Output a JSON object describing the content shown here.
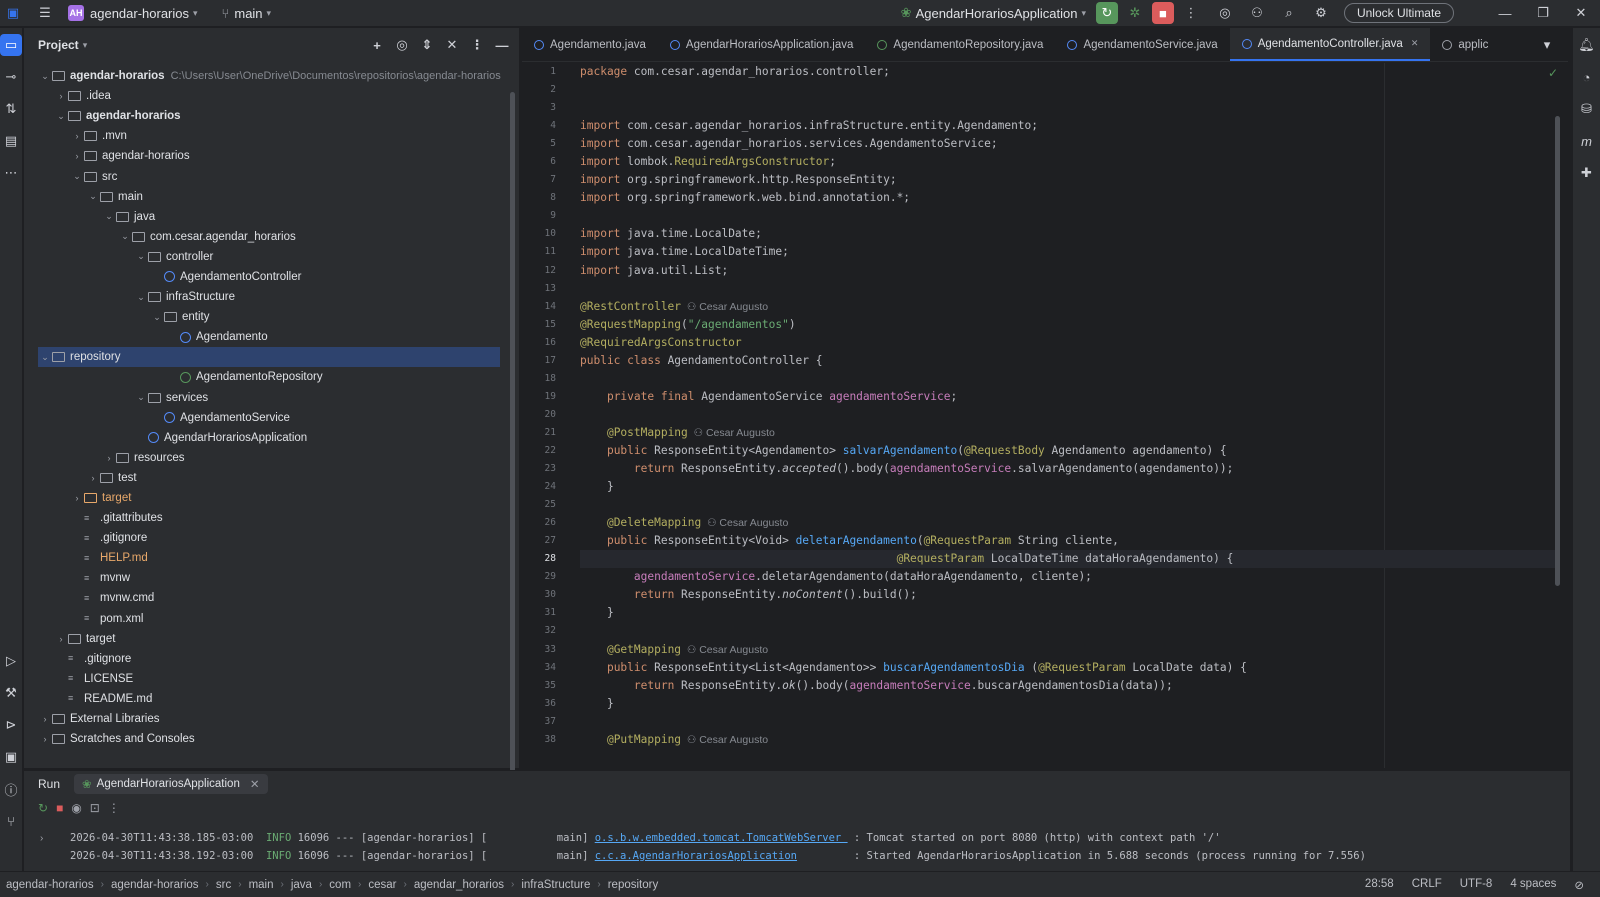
{
  "titlebar": {
    "project": "agendar-horarios",
    "branch": "main",
    "run_config": "AgendarHorariosApplication",
    "unlock": "Unlock Ultimate",
    "badge": "AH"
  },
  "project_panel": {
    "title": "Project"
  },
  "tree": [
    {
      "d": 0,
      "t": "v",
      "k": "m",
      "label": "agendar-horarios",
      "path": "C:\\Users\\User\\OneDrive\\Documentos\\repositorios\\agendar-horarios",
      "bold": true
    },
    {
      "d": 1,
      "t": ">",
      "k": "f",
      "label": ".idea"
    },
    {
      "d": 1,
      "t": "v",
      "k": "f",
      "label": "agendar-horarios",
      "bold": true
    },
    {
      "d": 2,
      "t": ">",
      "k": "f",
      "label": ".mvn"
    },
    {
      "d": 2,
      "t": ">",
      "k": "f",
      "label": "agendar-horarios"
    },
    {
      "d": 2,
      "t": "v",
      "k": "f",
      "label": "src"
    },
    {
      "d": 3,
      "t": "v",
      "k": "f",
      "label": "main"
    },
    {
      "d": 4,
      "t": "v",
      "k": "f",
      "label": "java"
    },
    {
      "d": 5,
      "t": "v",
      "k": "f",
      "label": "com.cesar.agendar_horarios"
    },
    {
      "d": 6,
      "t": "v",
      "k": "f",
      "label": "controller"
    },
    {
      "d": 7,
      "t": "",
      "k": "c",
      "label": "AgendamentoController"
    },
    {
      "d": 6,
      "t": "v",
      "k": "f",
      "label": "infraStructure"
    },
    {
      "d": 7,
      "t": "v",
      "k": "f",
      "label": "entity"
    },
    {
      "d": 8,
      "t": "",
      "k": "c",
      "label": "Agendamento"
    },
    {
      "d": 7,
      "t": "v",
      "k": "f",
      "label": "repository",
      "sel": true
    },
    {
      "d": 8,
      "t": "",
      "k": "i",
      "label": "AgendamentoRepository"
    },
    {
      "d": 6,
      "t": "v",
      "k": "f",
      "label": "services"
    },
    {
      "d": 7,
      "t": "",
      "k": "c",
      "label": "AgendamentoService"
    },
    {
      "d": 6,
      "t": "",
      "k": "c",
      "label": "AgendarHorariosApplication"
    },
    {
      "d": 4,
      "t": ">",
      "k": "f",
      "label": "resources"
    },
    {
      "d": 3,
      "t": ">",
      "k": "f",
      "label": "test"
    },
    {
      "d": 2,
      "t": ">",
      "k": "f",
      "label": "target",
      "orange": true
    },
    {
      "d": 2,
      "t": "",
      "k": "x",
      "label": ".gitattributes"
    },
    {
      "d": 2,
      "t": "",
      "k": "x",
      "label": ".gitignore"
    },
    {
      "d": 2,
      "t": "",
      "k": "x",
      "label": "HELP.md",
      "orange": true
    },
    {
      "d": 2,
      "t": "",
      "k": "x",
      "label": "mvnw"
    },
    {
      "d": 2,
      "t": "",
      "k": "x",
      "label": "mvnw.cmd"
    },
    {
      "d": 2,
      "t": "",
      "k": "x",
      "label": "pom.xml"
    },
    {
      "d": 1,
      "t": ">",
      "k": "f",
      "label": "target"
    },
    {
      "d": 1,
      "t": "",
      "k": "x",
      "label": ".gitignore"
    },
    {
      "d": 1,
      "t": "",
      "k": "x",
      "label": "LICENSE"
    },
    {
      "d": 1,
      "t": "",
      "k": "x",
      "label": "README.md"
    },
    {
      "d": 0,
      "t": ">",
      "k": "f",
      "label": "External Libraries"
    },
    {
      "d": 0,
      "t": ">",
      "k": "f",
      "label": "Scratches and Consoles"
    }
  ],
  "tabs": [
    {
      "label": "Agendamento.java",
      "icon": "c"
    },
    {
      "label": "AgendarHorariosApplication.java",
      "icon": "c"
    },
    {
      "label": "AgendamentoRepository.java",
      "icon": "g"
    },
    {
      "label": "AgendamentoService.java",
      "icon": "c"
    },
    {
      "label": "AgendamentoController.java",
      "icon": "c",
      "active": true
    },
    {
      "label": "applic",
      "icon": "x"
    }
  ],
  "current_line": 28,
  "code": [
    [
      [
        "kw",
        "package "
      ],
      [
        "",
        "com.cesar.agendar_horarios.controller;"
      ]
    ],
    [],
    [],
    [
      [
        "kw",
        "import "
      ],
      [
        "",
        "com.cesar.agendar_horarios.infraStructure.entity.Agendamento;"
      ]
    ],
    [
      [
        "kw",
        "import "
      ],
      [
        "",
        "com.cesar.agendar_horarios.services.AgendamentoService;"
      ]
    ],
    [
      [
        "kw",
        "import "
      ],
      [
        "",
        "lombok."
      ],
      [
        "an",
        "RequiredArgsConstructor"
      ],
      [
        "",
        ";"
      ]
    ],
    [
      [
        "kw",
        "import "
      ],
      [
        "",
        "org.springframework.http.ResponseEntity;"
      ]
    ],
    [
      [
        "kw",
        "import "
      ],
      [
        "",
        "org.springframework.web.bind.annotation.*;"
      ]
    ],
    [],
    [
      [
        "kw",
        "import "
      ],
      [
        "",
        "java.time.LocalDate;"
      ]
    ],
    [
      [
        "kw",
        "import "
      ],
      [
        "",
        "java.time.LocalDateTime;"
      ]
    ],
    [
      [
        "kw",
        "import "
      ],
      [
        "",
        "java.util.List;"
      ]
    ],
    [],
    [
      [
        "an",
        "@RestController"
      ],
      [
        "au",
        "  ⚇ Cesar Augusto"
      ]
    ],
    [
      [
        "an",
        "@RequestMapping"
      ],
      [
        "",
        "("
      ],
      [
        "st",
        "\"/agendamentos\""
      ],
      [
        "",
        ")"
      ]
    ],
    [
      [
        "an",
        "@RequiredArgsConstructor"
      ]
    ],
    [
      [
        "kw",
        "public class "
      ],
      [
        "",
        "AgendamentoController {"
      ]
    ],
    [],
    [
      [
        "",
        "    "
      ],
      [
        "kw",
        "private final "
      ],
      [
        "",
        "AgendamentoService "
      ],
      [
        "fd",
        "agendamentoService"
      ],
      [
        "",
        ";"
      ]
    ],
    [],
    [
      [
        "",
        "    "
      ],
      [
        "an",
        "@PostMapping"
      ],
      [
        "au",
        "  ⚇ Cesar Augusto"
      ]
    ],
    [
      [
        "",
        "    "
      ],
      [
        "kw",
        "public "
      ],
      [
        "",
        "ResponseEntity<Agendamento> "
      ],
      [
        "fn",
        "salvarAgendamento"
      ],
      [
        "",
        "("
      ],
      [
        "an",
        "@RequestBody "
      ],
      [
        "",
        "Agendamento agendamento) {"
      ]
    ],
    [
      [
        "",
        "        "
      ],
      [
        "kw",
        "return "
      ],
      [
        "",
        "ResponseEntity."
      ],
      [
        "it",
        "accepted"
      ],
      [
        "",
        "().body("
      ],
      [
        "fd",
        "agendamentoService"
      ],
      [
        "",
        ".salvarAgendamento(agendamento));"
      ]
    ],
    [
      [
        "",
        "    }"
      ]
    ],
    [],
    [
      [
        "",
        "    "
      ],
      [
        "an",
        "@DeleteMapping"
      ],
      [
        "au",
        "  ⚇ Cesar Augusto"
      ]
    ],
    [
      [
        "",
        "    "
      ],
      [
        "kw",
        "public "
      ],
      [
        "",
        "ResponseEntity<Void> "
      ],
      [
        "fn",
        "deletarAgendamento"
      ],
      [
        "",
        "("
      ],
      [
        "an",
        "@RequestParam "
      ],
      [
        "",
        "String cliente,"
      ]
    ],
    [
      [
        "",
        "                                               "
      ],
      [
        "an",
        "@RequestParam "
      ],
      [
        "",
        "LocalDateTime dataHoraAgendamento) {"
      ]
    ],
    [
      [
        "",
        "        "
      ],
      [
        "fd",
        "agendamentoService"
      ],
      [
        "",
        ".deletarAgendamento(dataHoraAgendamento, cliente);"
      ]
    ],
    [
      [
        "",
        "        "
      ],
      [
        "kw",
        "return "
      ],
      [
        "",
        "ResponseEntity."
      ],
      [
        "it",
        "noContent"
      ],
      [
        "",
        "().build();"
      ]
    ],
    [
      [
        "",
        "    }"
      ]
    ],
    [],
    [
      [
        "",
        "    "
      ],
      [
        "an",
        "@GetMapping"
      ],
      [
        "au",
        "  ⚇ Cesar Augusto"
      ]
    ],
    [
      [
        "",
        "    "
      ],
      [
        "kw",
        "public "
      ],
      [
        "",
        "ResponseEntity<List<Agendamento>> "
      ],
      [
        "fn",
        "buscarAgendamentosDia"
      ],
      [
        "",
        " ("
      ],
      [
        "an",
        "@RequestParam "
      ],
      [
        "",
        "LocalDate data) {"
      ]
    ],
    [
      [
        "",
        "        "
      ],
      [
        "kw",
        "return "
      ],
      [
        "",
        "ResponseEntity."
      ],
      [
        "it",
        "ok"
      ],
      [
        "",
        "().body("
      ],
      [
        "fd",
        "agendamentoService"
      ],
      [
        "",
        ".buscarAgendamentosDia(data));"
      ]
    ],
    [
      [
        "",
        "    }"
      ]
    ],
    [],
    [
      [
        "",
        "    "
      ],
      [
        "an",
        "@PutMapping"
      ],
      [
        "au",
        "  ⚇ Cesar Augusto"
      ]
    ]
  ],
  "run": {
    "label": "Run",
    "tab": "AgendarHorariosApplication",
    "logs": [
      {
        "ts": "2026-04-30T11:43:38.185-03:00",
        "lvl": "INFO",
        "rest": " 16096 --- [agendar-horarios] [           main] ",
        "src": "o.s.b.w.embedded.tomcat.TomcatWebServer ",
        "msg": " : Tomcat started on port 8080 (http) with context path '/'"
      },
      {
        "ts": "2026-04-30T11:43:38.192-03:00",
        "lvl": "INFO",
        "rest": " 16096 --- [agendar-horarios] [           main] ",
        "src": "c.c.a.AgendarHorariosApplication",
        "msg": "         : Started AgendarHorariosApplication in 5.688 seconds (process running for 7.556)"
      }
    ]
  },
  "status": {
    "breadcrumb": [
      "agendar-horarios",
      "agendar-horarios",
      "src",
      "main",
      "java",
      "com",
      "cesar",
      "agendar_horarios",
      "infraStructure",
      "repository"
    ],
    "position": "28:58",
    "line_sep": "CRLF",
    "encoding": "UTF-8",
    "indent": "4 spaces"
  }
}
